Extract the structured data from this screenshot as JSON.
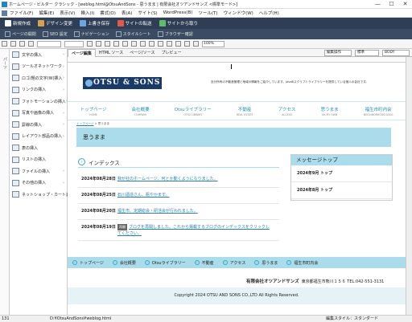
{
  "window": {
    "title": "ホームページ・ビルダー クラシック - [weblog.html@OtsuAndSons - 思うまま | 有限会社オツアンドサンズ <標準モード>]",
    "minimize": "—",
    "maximize": "☐",
    "close": "✕"
  },
  "menu": [
    "ファイル(F)",
    "編集(E)",
    "表示(V)",
    "挿入(I)",
    "書式(O)",
    "表(A)",
    "サイト(S)",
    "WordPress(B)",
    "ツール(T)",
    "ウィンドウ(W)",
    "ヘルプ(H)"
  ],
  "toolbar1": [
    "新規作成",
    "デザイン変更",
    "上書き保存",
    "サイトの転送",
    "サイトから取り"
  ],
  "toolbar2": [
    "ページの開閉",
    "SEO 設定",
    "ナビゲーション",
    "スタイルシート",
    "ブラウザー確認"
  ],
  "toolbar3": {
    "zoom": "100%"
  },
  "edit_tabs": {
    "tabs": [
      "ページ編集",
      "HTML ソース",
      "ページ/ソース",
      "プレビュー"
    ],
    "style_select": "編集操作",
    "mode_select": "標準",
    "body_select": "BODY"
  },
  "left_strip_label": "パーツ",
  "parts": [
    "文字の挿入",
    "ツールオネットワーク",
    "ロゴ/題の文字(W)挿入",
    "リンクの挿入",
    "フォトモーションの挿入",
    "写真や画像の挿入",
    "罫線の挿入",
    "レイアウト部品の挿入",
    "表の挿入",
    "リストの挿入",
    "ファイルの挿入",
    "その他の挿入",
    "ネットショップ・カート連携"
  ],
  "site": {
    "logo": "OTSU & SONS",
    "tagline": "自分所有の不動産管理と地域の情報をご紹介しています。JavaBスクリプトライブラリーを提供している個人の会社です。",
    "nav": [
      {
        "ja": "トップページ",
        "en": "HOME"
      },
      {
        "ja": "会社概要",
        "en": "COMPANY"
      },
      {
        "ja": "Otsuライブラリー",
        "en": "OTSU LIBRARY"
      },
      {
        "ja": "不動産",
        "en": "REAL ESTATE"
      },
      {
        "ja": "アクセス",
        "en": "ACCESS"
      },
      {
        "ja": "思うまま",
        "en": "OK MY OWN"
      },
      {
        "ja": "福生市町内会",
        "en": "NEIGHBORHOOD ASSO"
      }
    ],
    "breadcrumb_link": "トップページ",
    "breadcrumb_sep": " > ",
    "breadcrumb_current": "思うまま",
    "page_title": "思うまま",
    "index_title": "インデックス",
    "index_icon": "›",
    "entries": [
      {
        "date": "2024年08月28日",
        "text": "我が社のホームページ、何とか動くようになりました。",
        "badge": ""
      },
      {
        "date": "2024年08月25日",
        "text": "石川酒造さん、瓶やかます。",
        "badge": ""
      },
      {
        "date": "2024年08月20日",
        "text": "福生市、定期総会・研活会が行われました。",
        "badge": ""
      },
      {
        "date": "2024年08月19日",
        "text": "ブログを再開しました。これから掲載するブログのインデックスをクリックしてください。",
        "badge": "再開"
      }
    ],
    "message_top_title": "メッセージトップ",
    "message_top_items": [
      "2024年9月 トップ",
      "2024年8月 トップ"
    ],
    "footer_nav": [
      "トップページ",
      "会社概要",
      "Otsuライブラリー",
      "不動産",
      "アクセス",
      "思うまま",
      "福生市町内会"
    ],
    "footer_arrow": "›",
    "company_name": "有限会社オツアンドサンズ",
    "company_address": "東京都福生市熊川１５６ TEL:042-551-3131",
    "copyright": "Copyright 2024 OTSU AND SONS CO.,LTD All Rights Reserved."
  },
  "status": {
    "path": "D:¥OtsuAndSons¥weblog.html",
    "mode": "編集スタイル：スタンダード",
    "linecol": "131"
  },
  "colors": {
    "accent": "#aadceb",
    "toolbar_dark": "#2f3e55",
    "link": "#2a7fb0",
    "logo_bg": "#1a3a6a"
  }
}
